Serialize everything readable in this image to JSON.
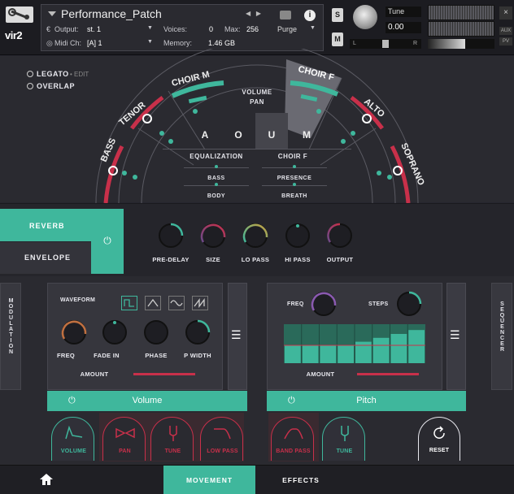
{
  "header": {
    "brand": "vir2",
    "instrument_title": "Performance_Patch",
    "output_label": "Output:",
    "output_value": "st. 1",
    "voices_label": "Voices:",
    "voices_value": "0",
    "max_label": "Max:",
    "max_value": "256",
    "purge_label": "Purge",
    "midi_label": "Midi Ch:",
    "midi_value": "[A]  1",
    "memory_label": "Memory:",
    "memory_value": "1.46 GB",
    "solo_label": "S",
    "mute_label": "M",
    "tune_label": "Tune",
    "tune_value": "0.00",
    "pan_left": "L",
    "pan_right": "R",
    "aux_label": "AUX",
    "pv_label": "PV",
    "info_label": "i"
  },
  "articulation": {
    "legato_label": "LEGATO",
    "edit_label": "• EDIT",
    "overlap_label": "OVERLAP"
  },
  "choir": {
    "sections": [
      "BASS",
      "TENOR",
      "CHOIR M",
      "CHOIR F",
      "ALTO",
      "SOPRANO"
    ],
    "volume_label": "VOLUME",
    "pan_label": "PAN",
    "vowels": [
      "A",
      "O",
      "U",
      "M"
    ],
    "active_vowel": "U",
    "eq_title": "EQUALIZATION",
    "eq_target": "CHOIR F",
    "eq_left": [
      "BASS",
      "BODY"
    ],
    "eq_right": [
      "PRESENCE",
      "BREATH"
    ]
  },
  "fx": {
    "reverb_tab": "REVERB",
    "envelope_tab": "ENVELOPE",
    "power_icon": "⏻",
    "knobs": [
      "PRE-DELAY",
      "SIZE",
      "LO PASS",
      "HI PASS",
      "OUTPUT"
    ]
  },
  "modulation": {
    "side_label": "MODULATION",
    "waveform_label": "WAVEFORM",
    "knobs": [
      "FREQ",
      "FADE IN",
      "PHASE",
      "P WIDTH"
    ],
    "amount_label": "AMOUNT",
    "target": "Volume",
    "cards": [
      {
        "label": "VOLUME",
        "active": true
      },
      {
        "label": "PAN",
        "active": false
      },
      {
        "label": "TUNE",
        "active": false
      },
      {
        "label": "LOW PASS",
        "active": false
      }
    ]
  },
  "sequencer": {
    "side_label": "SEQUENCER",
    "freq_label": "FREQ",
    "steps_label": "STEPS",
    "amount_label": "AMOUNT",
    "target": "Pitch",
    "steps": [
      0.45,
      0.45,
      0.45,
      0.45,
      0.55,
      0.65,
      0.75,
      0.85
    ],
    "cards": [
      {
        "label": "BAND PASS",
        "active": false
      },
      {
        "label": "TUNE",
        "active": true
      }
    ],
    "reset_label": "RESET"
  },
  "footer": {
    "movement_tab": "MOVEMENT",
    "effects_tab": "EFFECTS"
  },
  "colors": {
    "accent": "#3fb79c",
    "warning": "#c8304a"
  }
}
